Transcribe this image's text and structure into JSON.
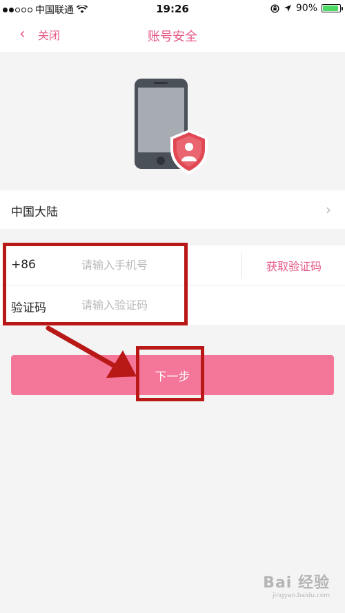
{
  "status_bar": {
    "carrier": "中国联通",
    "time": "19:26",
    "battery": "90%",
    "battery_level": 0.9
  },
  "nav": {
    "back_label": "关闭",
    "title": "账号安全"
  },
  "region": {
    "label": "中国大陆"
  },
  "form": {
    "country_code": "+86",
    "phone_placeholder": "请输入手机号",
    "get_code_label": "获取验证码",
    "code_label": "验证码",
    "code_placeholder": "请输入验证码"
  },
  "next_button": {
    "label": "下一步"
  },
  "watermark": {
    "main": "Bai 经验",
    "sub": "jingyan.baidu.com"
  },
  "colors": {
    "accent": "#e65a86",
    "button": "#f47699",
    "annotation": "#b81816",
    "shield": "#e04854"
  }
}
